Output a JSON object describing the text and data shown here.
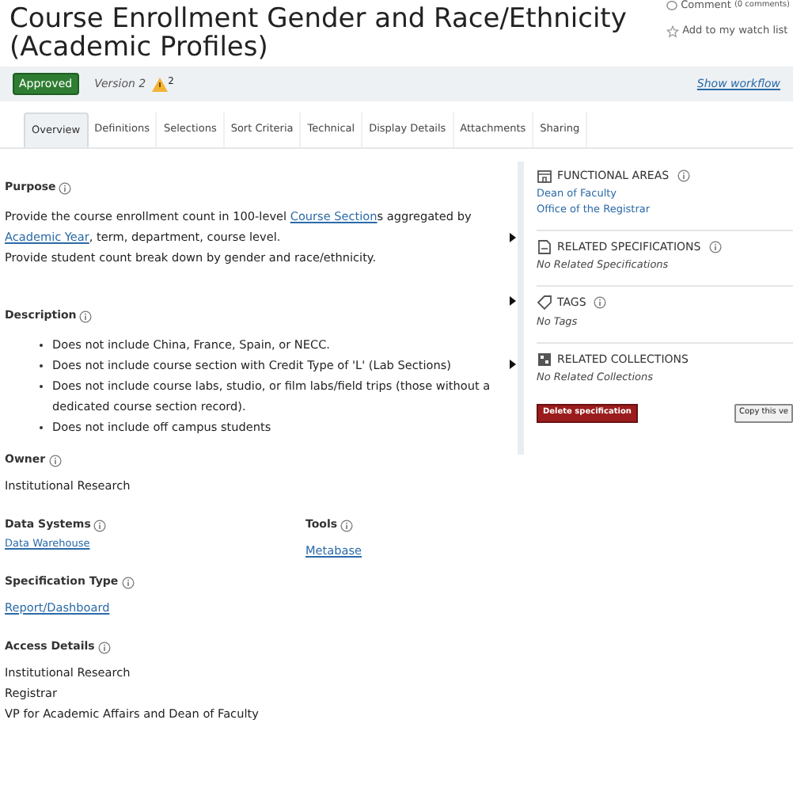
{
  "header": {
    "title": "Course Enrollment Gender and Race/Ethnicity (Academic Profiles)",
    "comment": "Comment",
    "comment_count": "(0 comments)",
    "watch": "Add to my watch list"
  },
  "status_bar": {
    "status": "Approved",
    "version": "Version 2",
    "warning_count": "2",
    "workflow_link": "Show workflow"
  },
  "tabs": [
    {
      "label": "Overview",
      "selected": true
    },
    {
      "label": "Definitions",
      "selected": false
    },
    {
      "label": "Selections",
      "selected": false
    },
    {
      "label": "Sort Criteria",
      "selected": false
    },
    {
      "label": "Technical",
      "selected": false
    },
    {
      "label": "Display Details",
      "selected": false
    },
    {
      "label": "Attachments",
      "selected": false
    },
    {
      "label": "Sharing",
      "selected": false
    }
  ],
  "purpose": {
    "label": "Purpose",
    "lines": [
      [
        {
          "text": "Provide the course enrollment count in 100-level "
        },
        {
          "text": "Course Section",
          "link": true
        },
        {
          "text": "s aggregated by "
        },
        {
          "text": "Academic Year",
          "link": true
        },
        {
          "text": ", term, department, course level."
        }
      ],
      [
        {
          "text": "Provide student count break down by gender and race/ethnicity."
        }
      ]
    ]
  },
  "description": {
    "label": "Description",
    "items": [
      "Does not include China, France, Spain, or NECC.",
      "Does not include course section with Credit Type of 'L' (Lab Sections)",
      "Does not include course labs, studio, or film labs/field trips (those without a dedicated course section record).",
      "Does not include off campus students"
    ]
  },
  "owner": {
    "label": "Owner",
    "value": "Institutional Research"
  },
  "data_systems": {
    "label": "Data Systems",
    "value": "Data Warehouse"
  },
  "tools": {
    "label": "Tools",
    "value": "Metabase"
  },
  "specification_type": {
    "label": "Specification Type",
    "value": "Report/Dashboard"
  },
  "access_details": {
    "label": "Access Details",
    "values": [
      "Institutional Research",
      "Registrar",
      "VP for Academic Affairs and Dean of Faculty"
    ]
  },
  "sidebar": {
    "sections": [
      {
        "kind": "building",
        "title": "FUNCTIONAL AREAS",
        "info": true,
        "links": [
          "Dean of Faculty",
          "Office of the Registrar"
        ]
      },
      {
        "kind": "document",
        "title": "RELATED SPECIFICATIONS",
        "info": true,
        "empty": "No Related Specifications"
      },
      {
        "kind": "tag",
        "title": "TAGS",
        "info": true,
        "empty": "No Tags"
      },
      {
        "kind": "collection",
        "title": "RELATED COLLECTIONS",
        "info": false,
        "empty": "No Related Collections"
      }
    ],
    "delete_button": "Delete specification",
    "copy_button": "Copy this ve"
  }
}
